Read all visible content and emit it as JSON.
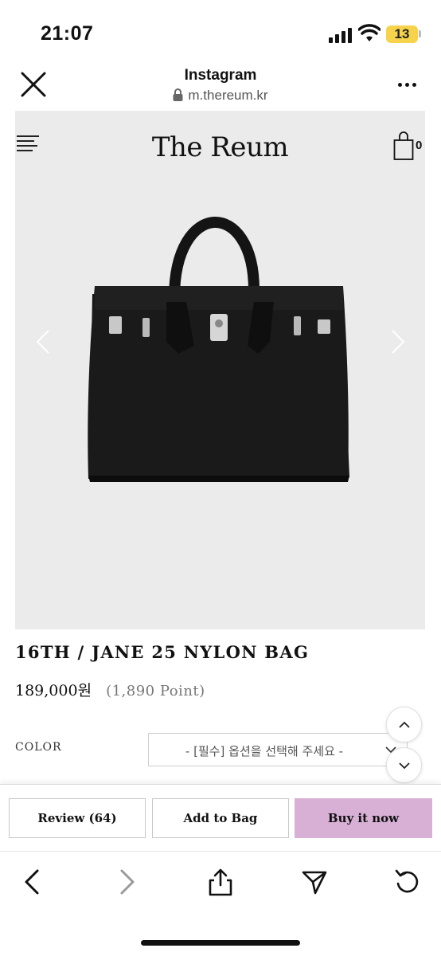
{
  "status_bar": {
    "time": "21:07",
    "battery": "13",
    "icons": [
      "signal-icon",
      "wifi-icon",
      "battery-icon"
    ]
  },
  "browser": {
    "title": "Instagram",
    "url": "m.thereum.kr",
    "icons": [
      "close-icon",
      "lock-icon",
      "more-icon"
    ]
  },
  "site": {
    "logo": "The Reum",
    "cart_count": "0",
    "icons": [
      "menu-icon",
      "cart-icon"
    ]
  },
  "product": {
    "image_icons": [
      "chevron-left-icon",
      "chevron-right-icon"
    ],
    "title": "16TH / JANE 25 NYLON BAG",
    "price": "189,000원",
    "points": "(1,890 Point)",
    "color_label": "COLOR",
    "color_select_placeholder": "- [필수] 옵션을 선택해 주세요 -"
  },
  "actions": {
    "review": "Review (64)",
    "add_to_bag": "Add to Bag",
    "buy_now": "Buy it now",
    "buy_color": "#d8b0d6"
  },
  "toolbar": {
    "icons": [
      "back-icon",
      "forward-icon",
      "share-icon",
      "send-icon",
      "reload-icon"
    ]
  }
}
